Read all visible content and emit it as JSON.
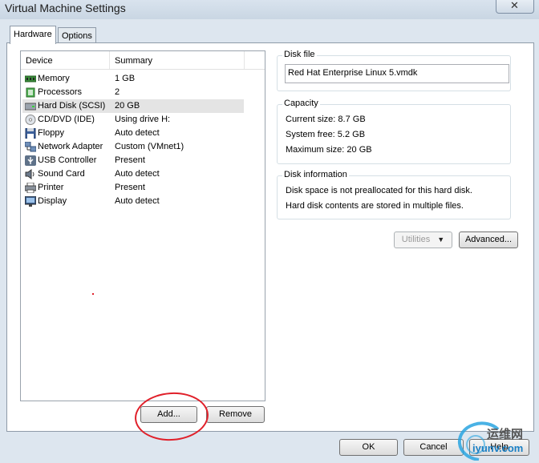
{
  "window": {
    "title": "Virtual Machine Settings"
  },
  "tabs": [
    {
      "label": "Hardware"
    },
    {
      "label": "Options"
    }
  ],
  "device_list": {
    "col_device": "Device",
    "col_summary": "Summary",
    "rows": [
      {
        "device": "Memory",
        "summary": "1 GB",
        "icon": "memory-icon"
      },
      {
        "device": "Processors",
        "summary": "2",
        "icon": "processor-icon"
      },
      {
        "device": "Hard Disk (SCSI)",
        "summary": "20 GB",
        "icon": "hard-disk-icon"
      },
      {
        "device": "CD/DVD (IDE)",
        "summary": "Using drive H:",
        "icon": "cd-dvd-icon"
      },
      {
        "device": "Floppy",
        "summary": "Auto detect",
        "icon": "floppy-icon"
      },
      {
        "device": "Network Adapter",
        "summary": "Custom (VMnet1)",
        "icon": "network-adapter-icon"
      },
      {
        "device": "USB Controller",
        "summary": "Present",
        "icon": "usb-icon"
      },
      {
        "device": "Sound Card",
        "summary": "Auto detect",
        "icon": "sound-card-icon"
      },
      {
        "device": "Printer",
        "summary": "Present",
        "icon": "printer-icon"
      },
      {
        "device": "Display",
        "summary": "Auto detect",
        "icon": "display-icon"
      }
    ],
    "selected": "Hard Disk (SCSI)"
  },
  "buttons": {
    "add": "Add...",
    "remove": "Remove",
    "utilities": "Utilities",
    "advanced": "Advanced...",
    "ok": "OK",
    "cancel": "Cancel",
    "help": "Help"
  },
  "disk_file": {
    "legend": "Disk file",
    "value": "Red Hat Enterprise Linux 5.vmdk"
  },
  "capacity": {
    "legend": "Capacity",
    "current_size": "Current size: 8.7 GB",
    "system_free": "System free: 5.2 GB",
    "maximum_size": "Maximum size:  20 GB"
  },
  "disk_info": {
    "legend": "Disk information",
    "line1": "Disk space is not preallocated for this hard disk.",
    "line2": "Hard disk contents are stored in multiple files."
  },
  "watermark": {
    "cn": "运维网",
    "url": "iyunv.com"
  },
  "colors": {
    "annotation": "#e0202a",
    "selected_row": "#e4e4e4",
    "window_bg": "#dde6ef"
  }
}
